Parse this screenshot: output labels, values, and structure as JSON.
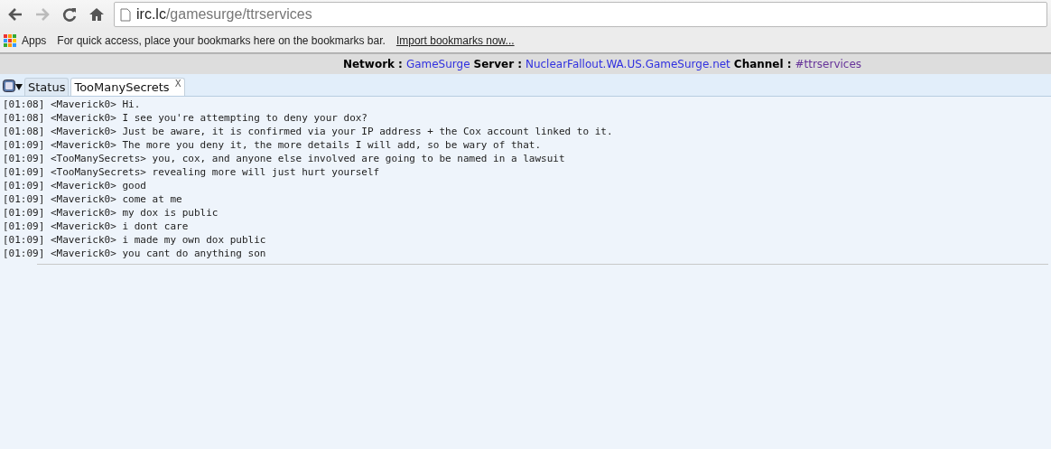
{
  "browser": {
    "url_host": "irc.lc",
    "url_path": "/gamesurge/ttrservices"
  },
  "bookmarks_bar": {
    "apps_label": "Apps",
    "hint": "For quick access, place your bookmarks here on the bookmarks bar.",
    "import_link": "Import bookmarks now..."
  },
  "info_bar": [
    {
      "label": "Network",
      "separator": ":",
      "value": "GameSurge",
      "visited": false
    },
    {
      "label": "Server",
      "separator": ":",
      "value": "NuclearFallout.WA.US.GameSurge.net",
      "visited": false
    },
    {
      "label": "Channel",
      "separator": ":",
      "value": "#ttrservices",
      "visited": true
    }
  ],
  "tabs": [
    {
      "label": "Status",
      "selected": false
    },
    {
      "label": "TooManySecrets",
      "selected": true,
      "close_label": "X"
    }
  ],
  "messages": [
    {
      "time": "[01:08]",
      "nick": "<Maverick0>",
      "text": "Hi."
    },
    {
      "time": "[01:08]",
      "nick": "<Maverick0>",
      "text": "I see you're attempting to deny your dox?"
    },
    {
      "time": "[01:08]",
      "nick": "<Maverick0>",
      "text": "Just be aware, it is confirmed via your IP address + the Cox account linked to it."
    },
    {
      "time": "[01:09]",
      "nick": "<Maverick0>",
      "text": "The more you deny it, the more details I will add, so be wary of that."
    },
    {
      "time": "[01:09]",
      "nick": "<TooManySecrets>",
      "text": "you, cox, and anyone else involved are going to be named in a lawsuit"
    },
    {
      "time": "[01:09]",
      "nick": "<TooManySecrets>",
      "text": "revealing more will just hurt yourself"
    },
    {
      "time": "[01:09]",
      "nick": "<Maverick0>",
      "text": "good"
    },
    {
      "time": "[01:09]",
      "nick": "<Maverick0>",
      "text": "come at me"
    },
    {
      "time": "[01:09]",
      "nick": "<Maverick0>",
      "text": "my dox is public"
    },
    {
      "time": "[01:09]",
      "nick": "<Maverick0>",
      "text": "i dont care"
    },
    {
      "time": "[01:09]",
      "nick": "<Maverick0>",
      "text": "i made my own dox public"
    },
    {
      "time": "[01:09]",
      "nick": "<Maverick0>",
      "text": "you cant do anything son"
    }
  ]
}
